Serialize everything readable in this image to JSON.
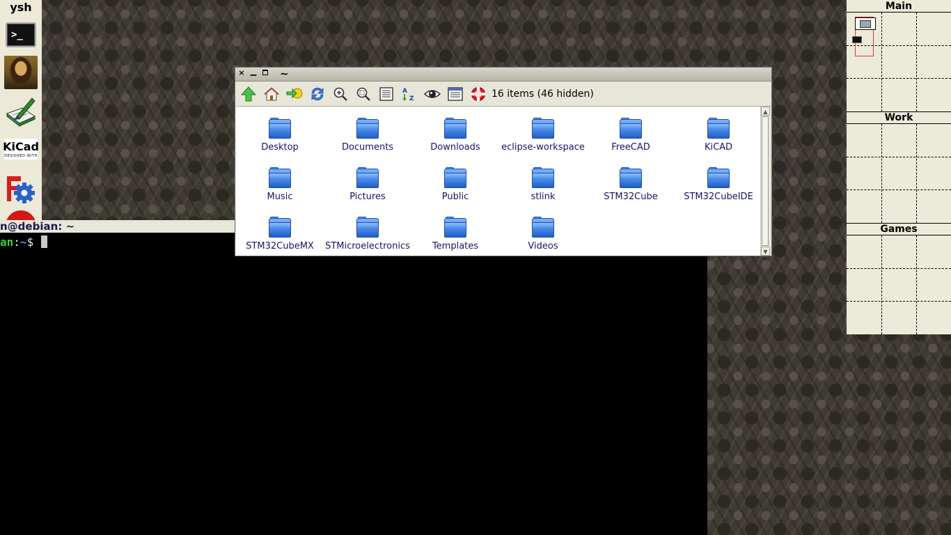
{
  "dock": {
    "title": "ysh",
    "apps": [
      {
        "name": "terminal",
        "icon": "terminal-icon",
        "glyph": ">_"
      },
      {
        "name": "image-viewer",
        "icon": "mona-lisa-icon"
      },
      {
        "name": "text-editor",
        "icon": "pen-notebook-icon"
      },
      {
        "name": "kicad",
        "icon": "kicad-icon",
        "text": "KiCad",
        "subtext": "DESIGNED WITH"
      },
      {
        "name": "freecad",
        "icon": "freecad-gear-icon"
      },
      {
        "name": "unknown",
        "icon": "red-circle-icon"
      }
    ]
  },
  "terminal": {
    "title": "n@debian: ~",
    "prompt_user": "an",
    "prompt_colon": ":",
    "prompt_path": "~",
    "prompt_symbol": "$ "
  },
  "file_manager": {
    "window_title": "~",
    "close_glyph": "×",
    "minimize_glyph": "▁",
    "maximize_glyph": "▫",
    "status": "16 items (46 hidden)",
    "toolbar_icons": [
      "up-arrow-icon",
      "home-icon",
      "go-icon",
      "refresh-icon",
      "zoom-in-icon",
      "zoom-fit-icon",
      "details-view-icon",
      "sort-az-icon",
      "show-hidden-icon",
      "list-view-icon",
      "help-icon"
    ],
    "items": [
      "Desktop",
      "Documents",
      "Downloads",
      "eclipse-workspace",
      "FreeCAD",
      "KiCAD",
      "Music",
      "Pictures",
      "Public",
      "stlink",
      "STM32Cube",
      "STM32CubeIDE",
      "STM32CubeMX",
      "STMicroelectronics",
      "Templates",
      "Videos"
    ],
    "scroll_up": "▲",
    "scroll_down": "▼"
  },
  "pager": {
    "desktops": [
      "Main",
      "Work",
      "Games"
    ]
  },
  "colors": {
    "accent_label": "#141466",
    "folder_blue": "#2a6ad8",
    "terminal_bg": "#000000",
    "panel_bg": "#ecead9"
  }
}
